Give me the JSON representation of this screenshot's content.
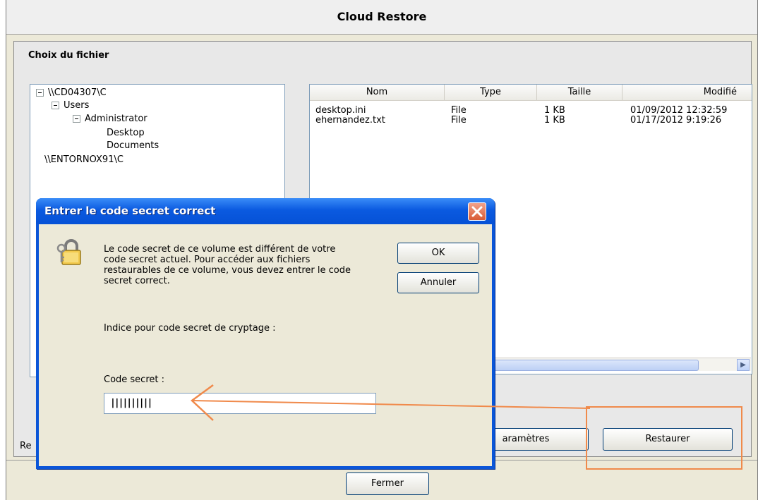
{
  "window": {
    "title": "Cloud Restore"
  },
  "file_chooser": {
    "group_title": "Choix du fichier",
    "tree": [
      {
        "label": "\\\\CD04307\\C",
        "expander": true
      },
      {
        "label": "Users",
        "expander": true
      },
      {
        "label": "Administrator",
        "expander": true
      },
      {
        "label": "Desktop",
        "expander": false
      },
      {
        "label": "Documents",
        "expander": false
      },
      {
        "label": "\\\\ENTORNOX91\\C",
        "expander": false
      }
    ],
    "columns": [
      "Nom",
      "Type",
      "Taille",
      "Modifié"
    ],
    "rows": [
      {
        "name": "desktop.ini",
        "type": "File",
        "size": "1 KB",
        "modified": "01/09/2012 12:32:59"
      },
      {
        "name": "ehernandez.txt",
        "type": "File",
        "size": "1 KB",
        "modified": "01/17/2012 9:19:26"
      }
    ],
    "partial_label": "Re",
    "parametres_label": "aramètres",
    "restaurer_label": "Restaurer"
  },
  "footer": {
    "fermer_label": "Fermer"
  },
  "dialog": {
    "title": "Entrer le code secret correct",
    "message_lines": [
      "Le code secret de ce volume est différent de votre",
      "code secret actuel.  Pour accéder aux fichiers",
      "restaurables de ce volume, vous devez entrer le code",
      "secret correct."
    ],
    "hint_label": "Indice pour code secret de cryptage :",
    "code_label": "Code secret :",
    "code_value": "||||||||||",
    "ok_label": "OK",
    "cancel_label": "Annuler"
  },
  "colors": {
    "highlight": "#f08a4b",
    "dialog_title": "#0a55d8"
  }
}
